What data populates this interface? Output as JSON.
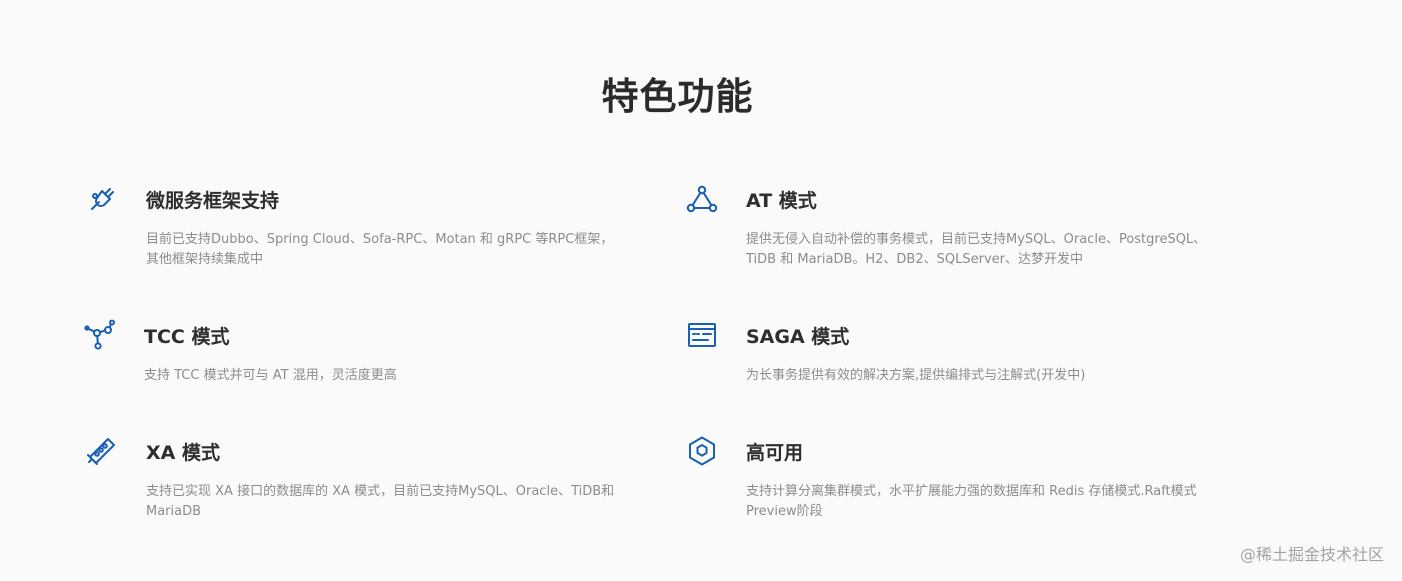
{
  "page": {
    "title": "特色功能"
  },
  "features": [
    {
      "icon": "plug-icon",
      "title": "微服务框架支持",
      "desc": "目前已支持Dubbo、Spring Cloud、Sofa-RPC、Motan 和 gRPC 等RPC框架，其他框架持续集成中"
    },
    {
      "icon": "network-triangle-icon",
      "title": "AT 模式",
      "desc": "提供无侵入自动补偿的事务模式，目前已支持MySQL、Oracle、PostgreSQL、TiDB 和 MariaDB。H2、DB2、SQLServer、达梦开发中"
    },
    {
      "icon": "molecule-icon",
      "title": "TCC 模式",
      "desc": "支持 TCC 模式并可与 AT 混用，灵活度更高"
    },
    {
      "icon": "console-window-icon",
      "title": "SAGA 模式",
      "desc": "为长事务提供有效的解决方案,提供编排式与注解式(开发中)"
    },
    {
      "icon": "memory-chip-icon",
      "title": "XA 模式",
      "desc": "支持已实现 XA 接口的数据库的 XA 模式，目前已支持MySQL、Oracle、TiDB和MariaDB"
    },
    {
      "icon": "hexagon-shield-icon",
      "title": "高可用",
      "desc": "支持计算分离集群模式，水平扩展能力强的数据库和 Redis 存储模式.Raft模式Preview阶段"
    }
  ],
  "watermark": "@稀土掘金技术社区",
  "colors": {
    "accent": "#1a5fb4",
    "background": "#fafafa",
    "title": "#2b2b2b",
    "description": "#8c8c8c"
  }
}
